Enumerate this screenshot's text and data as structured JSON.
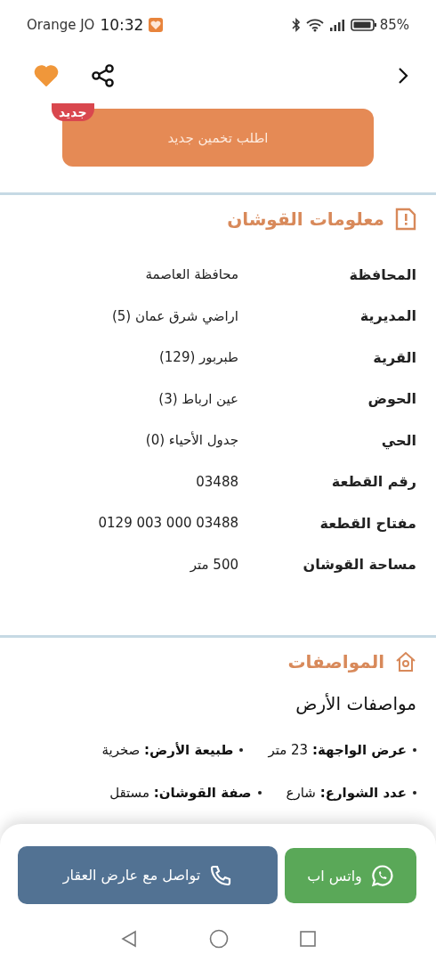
{
  "status_bar": {
    "carrier": "Orange JO",
    "time": "10:32",
    "battery": "85%"
  },
  "top_bar": {
    "favorite": true
  },
  "estimate_button": {
    "label": "اطلب تخمين جديد",
    "badge": "جديد"
  },
  "deed_info": {
    "title": "معلومات القوشان",
    "rows": [
      {
        "label": "المحافظة",
        "value": "محافظة العاصمة"
      },
      {
        "label": "المديرية",
        "value": "اراضي شرق عمان (5)"
      },
      {
        "label": "القرية",
        "value": "طبربور (129)"
      },
      {
        "label": "الحوض",
        "value": "عين ارباط (3)"
      },
      {
        "label": "الحي",
        "value": "جدول الأحياء (0)"
      },
      {
        "label": "رقم القطعة",
        "value": "03488"
      },
      {
        "label": "مفتاح القطعة",
        "value": "0129 003 000 03488"
      },
      {
        "label": "مساحة القوشان",
        "value": "500 متر"
      }
    ]
  },
  "specs": {
    "title": "المواصفات",
    "subtitle": "مواصفات الأرض",
    "rows": [
      [
        {
          "label": "عرض الواجهة:",
          "value": "23 متر"
        },
        {
          "label": "طبيعة الأرض:",
          "value": "صخرية"
        }
      ],
      [
        {
          "label": "عدد الشوارع:",
          "value": "شارع"
        },
        {
          "label": "صفة القوشان:",
          "value": "مستقل"
        }
      ]
    ]
  },
  "actions": [
    {
      "kind": "whatsapp",
      "label": "واتس اب"
    },
    {
      "kind": "call",
      "label": "تواصل مع عارض العقار"
    }
  ]
}
